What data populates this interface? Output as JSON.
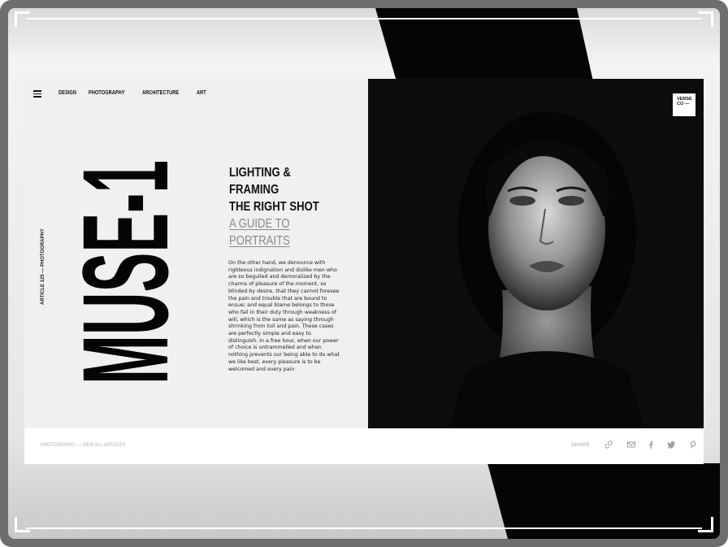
{
  "nav": {
    "items": [
      "DESIGN",
      "PHOTOGRAPHY",
      "ARCHITECTURE",
      "ART"
    ]
  },
  "hero": {
    "big_title": "MUSE-1",
    "side_label": "ARTICLE 125 — PHOTOGRAPHY"
  },
  "article": {
    "headline_line1": "LIGHTING & FRAMING",
    "headline_line2": "THE RIGHT SHOT",
    "subhead_line1": "A GUIDE TO",
    "subhead_line2": "PORTRAITS",
    "body": "On the other hand, we denounce with righteous indignation and dislike men who are so beguiled and demoralized by the charms of pleasure of the moment, so blinded by desire, that they cannot foresee the pain and trouble that are bound to ensue; and equal blame belongs to those who fail in their duty through weakness of will, which is the same as saying through shrinking from toil and pain. These cases are perfectly simple and easy to distinguish. In a free hour, when our power of choice is untrammelled and when nothing prevents our being able to do what we like best, every pleasure is to be welcomed and every pain"
  },
  "brand": {
    "line1": "VERSE",
    "line2": "CO —"
  },
  "footer": {
    "category": "PHOTOGRAPHY",
    "view_all": "— VIEW ALL ARTICLES",
    "share_label": "SHARE"
  },
  "icons": [
    "menu-icon",
    "link-icon",
    "mail-icon",
    "facebook-icon",
    "twitter-icon",
    "pinterest-icon"
  ],
  "colors": {
    "frame": "#6e6e6e",
    "panel_light": "#f1eff0",
    "panel_dark": "#0c0c0c",
    "muted": "#9a9a9a"
  }
}
